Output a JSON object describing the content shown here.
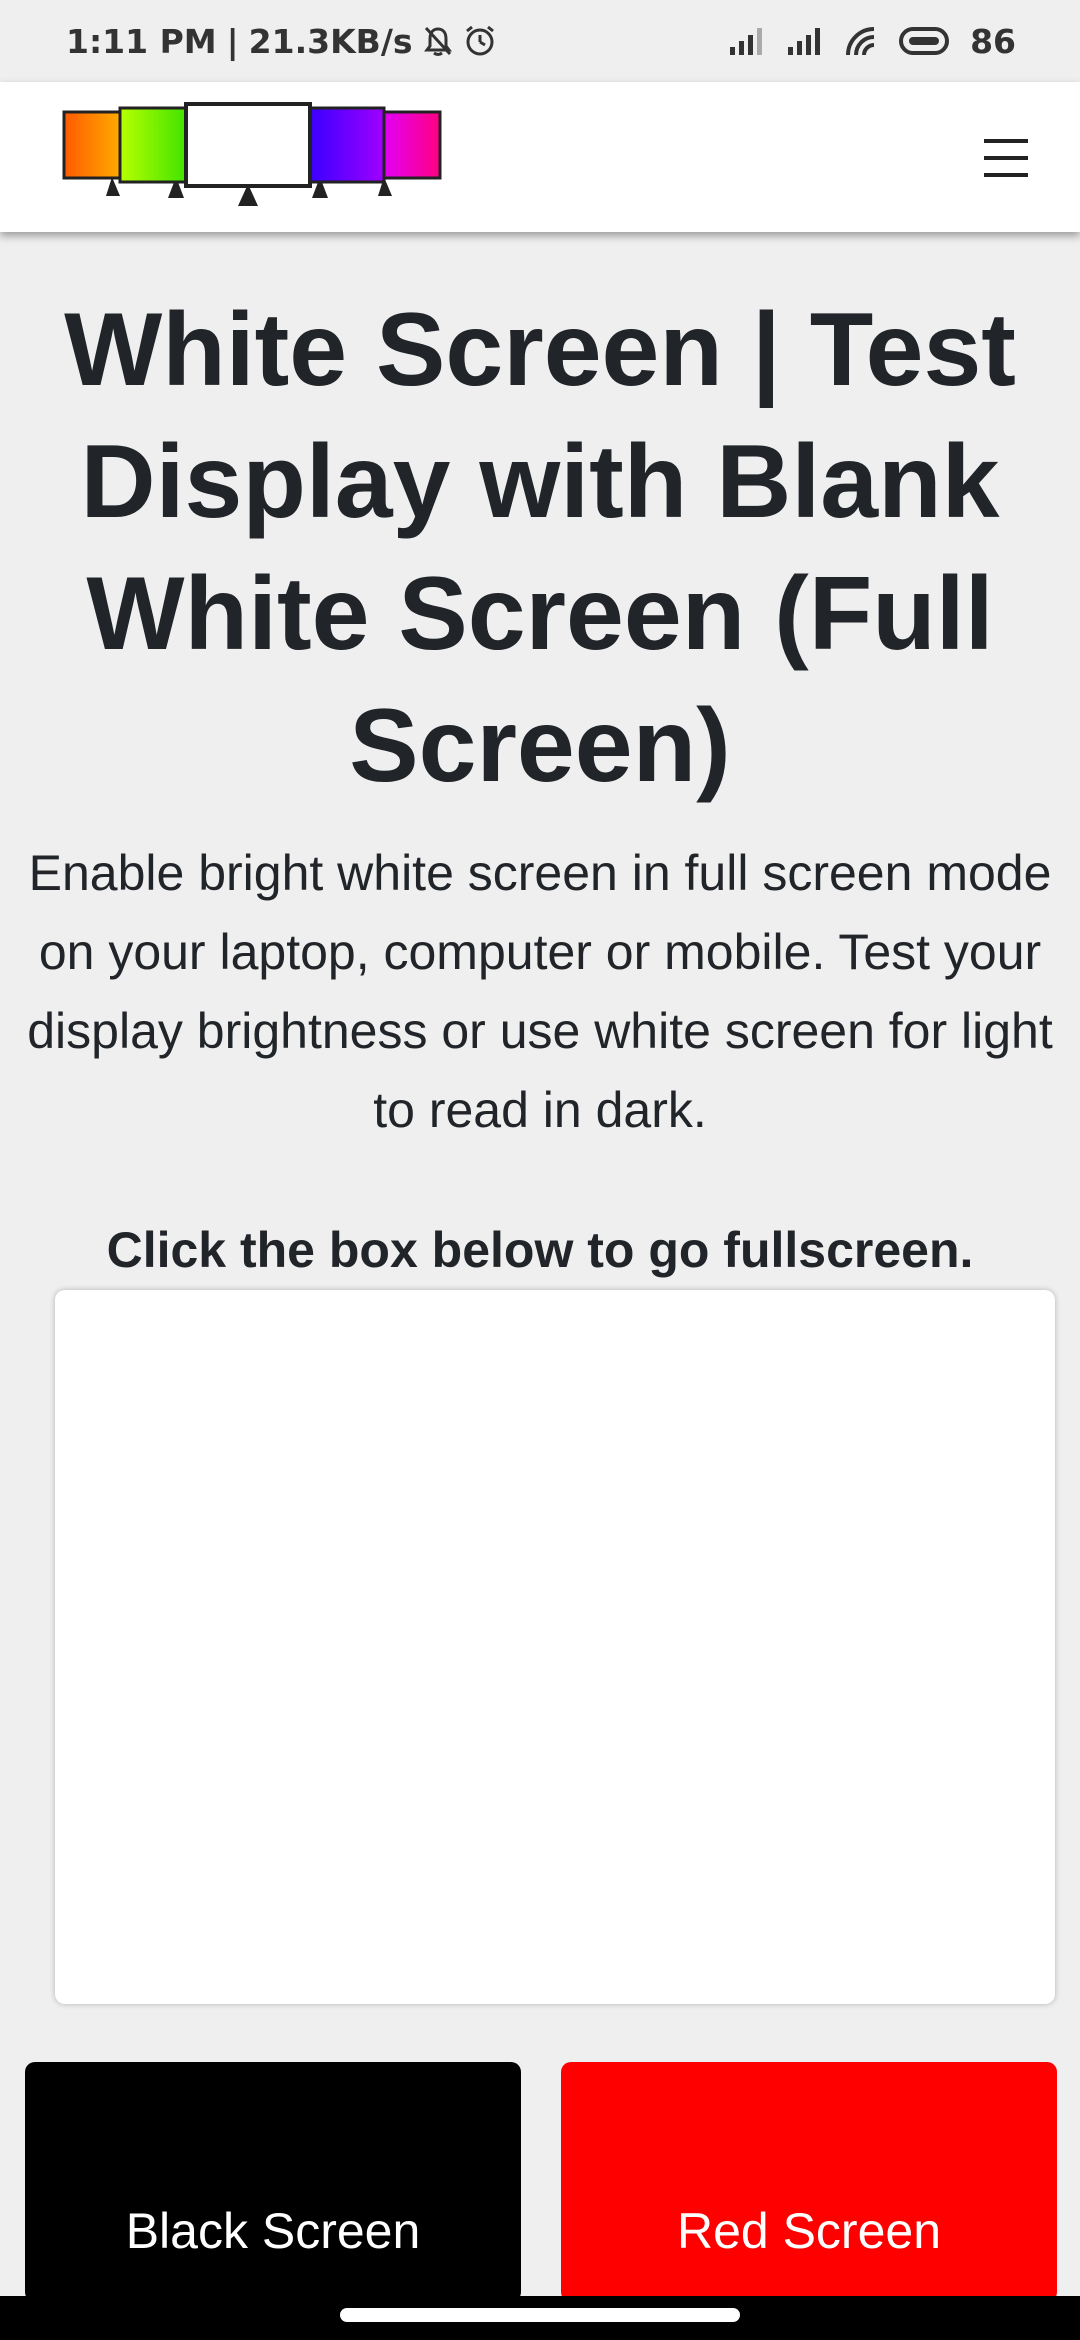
{
  "status_bar": {
    "time": "1:11 PM",
    "separator": "|",
    "net_speed": "21.3KB/s",
    "battery": "86",
    "icons": [
      "bell-muted-icon",
      "alarm-icon",
      "signal-icon",
      "signal-icon",
      "wifi-icon",
      "battery-icon"
    ]
  },
  "header": {
    "logo_colors": [
      "#ff7a00",
      "#7cff00",
      "#ffffff",
      "#6a00ff",
      "#ff00a8"
    ],
    "menu_icon": "hamburger-menu-icon"
  },
  "main": {
    "title": "White Screen | Test Display with Blank White Screen (Full Screen)",
    "intro": "Enable bright white screen in full screen mode on your laptop, computer or mobile. Test your display brightness or use white screen for light to read in dark.",
    "instruction": "Click the box below to go fullscreen."
  },
  "buttons": {
    "black_label": "Black Screen",
    "red_label": "Red Screen"
  },
  "colors": {
    "background": "#efefef",
    "text": "#212529",
    "black_button": "#000000",
    "red_button": "#ff0000"
  }
}
